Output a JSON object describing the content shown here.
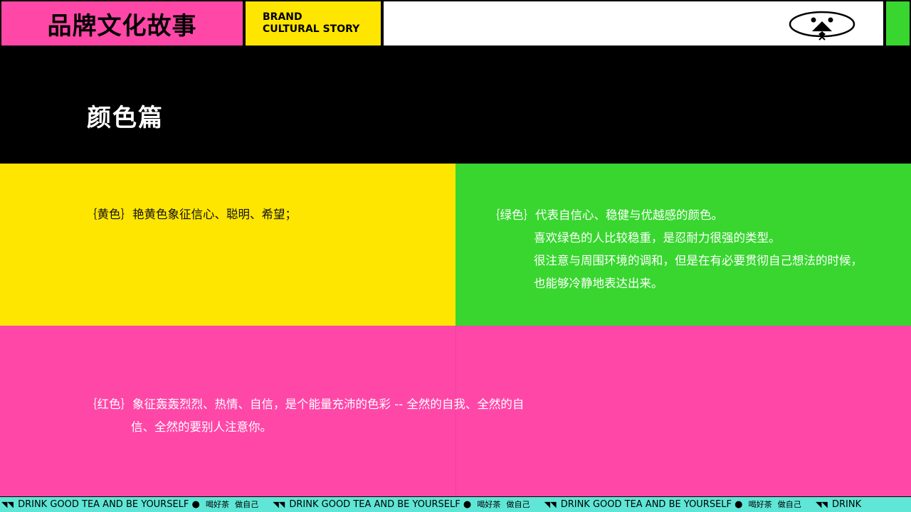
{
  "header": {
    "title_cn": "品牌文化故事",
    "title_en_line1": "BRAND",
    "title_en_line2": "CULTURAL STORY"
  },
  "section": {
    "title": "颜色篇"
  },
  "colors": {
    "pink": "#ff47a8",
    "yellow": "#ffe600",
    "green": "#38d62f",
    "black": "#000000",
    "white": "#ffffff",
    "ticker_bg": "#5fe6d6"
  },
  "yellow_block": {
    "line1": "｛黄色｝艳黄色象征信心、聪明、希望；"
  },
  "green_block": {
    "line1": "｛绿色｝代表自信心、稳健与优越感的颜色。",
    "line2": "喜欢绿色的人比较稳重，是忍耐力很强的类型。",
    "line3": "很注意与周围环境的调和，但是在有必要贯彻自己想法的时候，",
    "line4": "也能够冷静地表达出来。"
  },
  "pink_block": {
    "line1": "｛红色｝象征轰轰烈烈、热情、自信，是个能量充沛的色彩 -- 全然的自我、全然的自",
    "line2": "信、全然的要别人注意你。"
  },
  "ticker": {
    "items": [
      {
        "en": "DRINK GOOD TEA AND BE YOURSELF",
        "dot": "●",
        "cn1": "喝好茶",
        "cn2": "做自己"
      },
      {
        "en": "DRINK GOOD TEA AND BE YOURSELF",
        "dot": "●",
        "cn1": "喝好茶",
        "cn2": "做自己"
      },
      {
        "en": "DRINK GOOD TEA AND BE YOURSELF",
        "dot": "●",
        "cn1": "喝好茶",
        "cn2": "做自己"
      },
      {
        "en": "DRINK",
        "dot": "",
        "cn1": "",
        "cn2": ""
      }
    ]
  }
}
